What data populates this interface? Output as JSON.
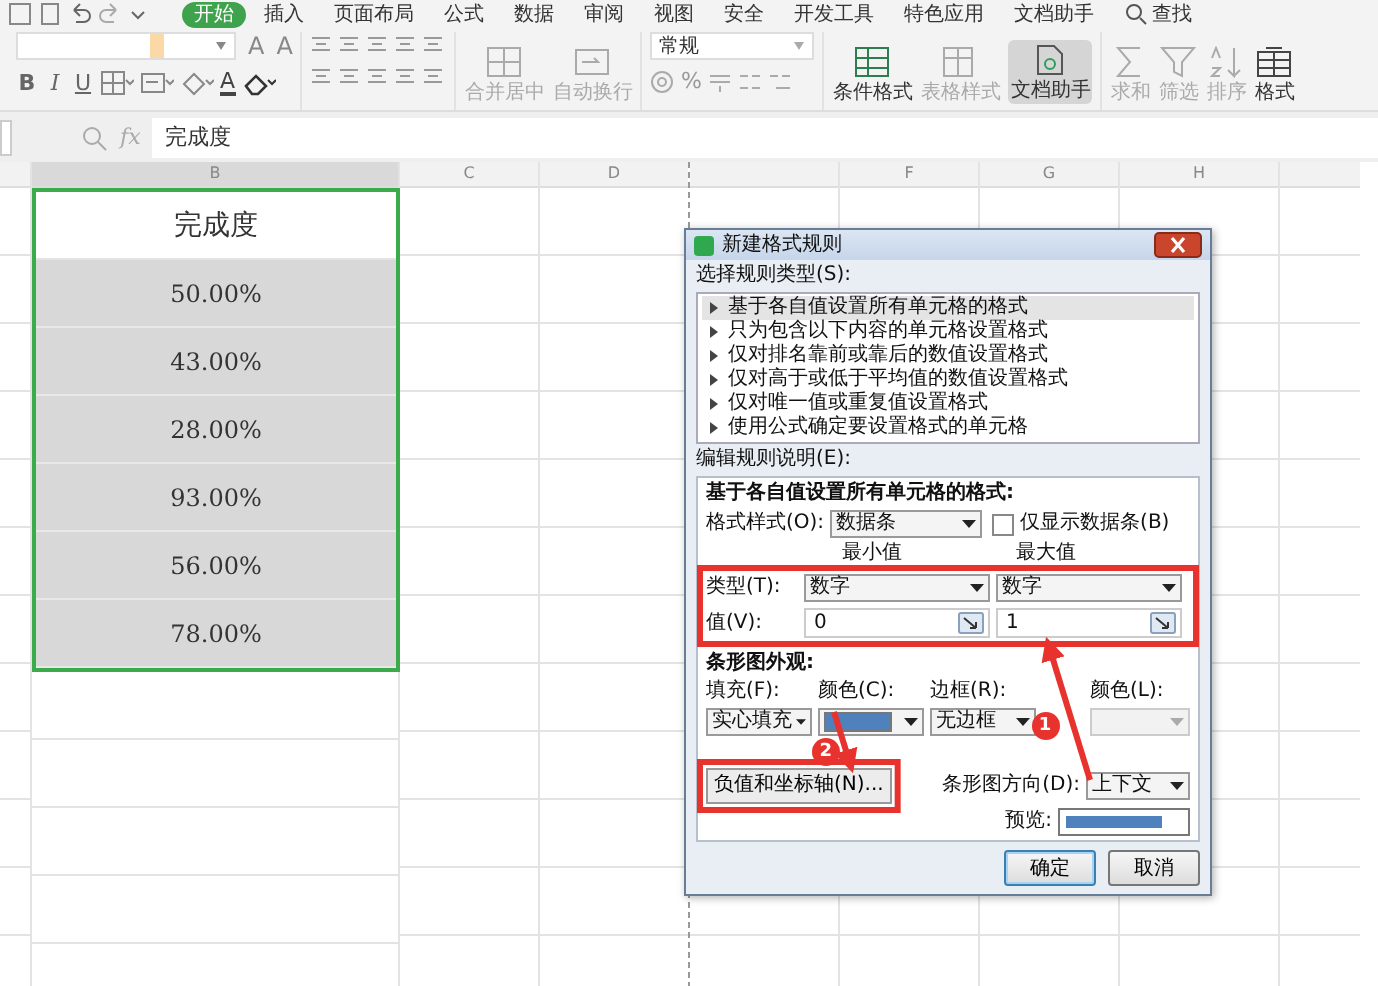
{
  "tabs": [
    {
      "label": "开始",
      "selected": true
    },
    {
      "label": "插入",
      "selected": false
    },
    {
      "label": "页面布局",
      "selected": false
    },
    {
      "label": "公式",
      "selected": false
    },
    {
      "label": "数据",
      "selected": false
    },
    {
      "label": "审阅",
      "selected": false
    },
    {
      "label": "视图",
      "selected": false
    },
    {
      "label": "安全",
      "selected": false
    },
    {
      "label": "开发工具",
      "selected": false
    },
    {
      "label": "特色应用",
      "selected": false
    },
    {
      "label": "文档助手",
      "selected": false
    }
  ],
  "search": {
    "label": "查找"
  },
  "font_size_buttons": [
    "A",
    "A"
  ],
  "font_style_buttons": [
    "B",
    "I",
    "U"
  ],
  "font_color_glyph": "A",
  "number_format": "常规",
  "percent_glyph": "%",
  "ribbon_buttons": [
    {
      "kind": "merge",
      "label": "合并居中",
      "disabled": true,
      "selected": false
    },
    {
      "kind": "wrap",
      "label": "自动换行",
      "disabled": true,
      "selected": false
    },
    {
      "kind": "conditional",
      "label": "条件格式",
      "disabled": false,
      "selected": false
    },
    {
      "kind": "table",
      "label": "表格样式",
      "disabled": true,
      "selected": false
    },
    {
      "kind": "assistant",
      "label": "文档助手",
      "disabled": false,
      "selected": true
    },
    {
      "kind": "sum",
      "label": "求和",
      "disabled": true,
      "selected": false
    },
    {
      "kind": "filter",
      "label": "筛选",
      "disabled": true,
      "selected": false
    },
    {
      "kind": "sort",
      "label": "排序",
      "disabled": true,
      "selected": false
    },
    {
      "kind": "format",
      "label": "格式",
      "disabled": false,
      "selected": false
    }
  ],
  "formula_bar": {
    "fx": "fx",
    "value": "完成度"
  },
  "sheet": {
    "column_headers": [
      "B",
      "C",
      "D",
      "F",
      "G",
      "H"
    ],
    "header_cell": "完成度",
    "values": [
      "50.00%",
      "43.00%",
      "28.00%",
      "93.00%",
      "56.00%",
      "78.00%"
    ]
  },
  "dialog": {
    "title": "新建格式规则",
    "rule_type_label": "选择规则类型(S):",
    "rule_types": [
      {
        "label": "基于各自值设置所有单元格的格式",
        "selected": true
      },
      {
        "label": "只为包含以下内容的单元格设置格式",
        "selected": false
      },
      {
        "label": "仅对排名靠前或靠后的数值设置格式",
        "selected": false
      },
      {
        "label": "仅对高于或低于平均值的数值设置格式",
        "selected": false
      },
      {
        "label": "仅对唯一值或重复值设置格式",
        "selected": false
      },
      {
        "label": "使用公式确定要设置格式的单元格",
        "selected": false
      }
    ],
    "edit_label": "编辑规则说明(E):",
    "section_title": "基于各自值设置所有单元格的格式:",
    "format_style_label": "格式样式(O):",
    "format_style": "数据条",
    "bar_only": {
      "label": "仅显示数据条(B)",
      "checked": false
    },
    "min_header": "最小值",
    "max_header": "最大值",
    "type_label": "类型(T):",
    "min_type": "数字",
    "max_type": "数字",
    "value_label": "值(V):",
    "min_value": "0",
    "max_value": "1",
    "appearance_title": "条形图外观:",
    "fill_label": "填充(F):",
    "fill_color_label": "颜色(C):",
    "border_label": "边框(R):",
    "border_color_label": "颜色(L):",
    "fill": "实心填充",
    "border": "无边框",
    "axis_button": "负值和坐标轴(N)...",
    "direction_label": "条形图方向(D):",
    "direction": "上下文",
    "preview_label": "预览:",
    "ok": "确定",
    "cancel": "取消"
  },
  "annotations": [
    {
      "label": "1"
    },
    {
      "label": "2"
    }
  ]
}
